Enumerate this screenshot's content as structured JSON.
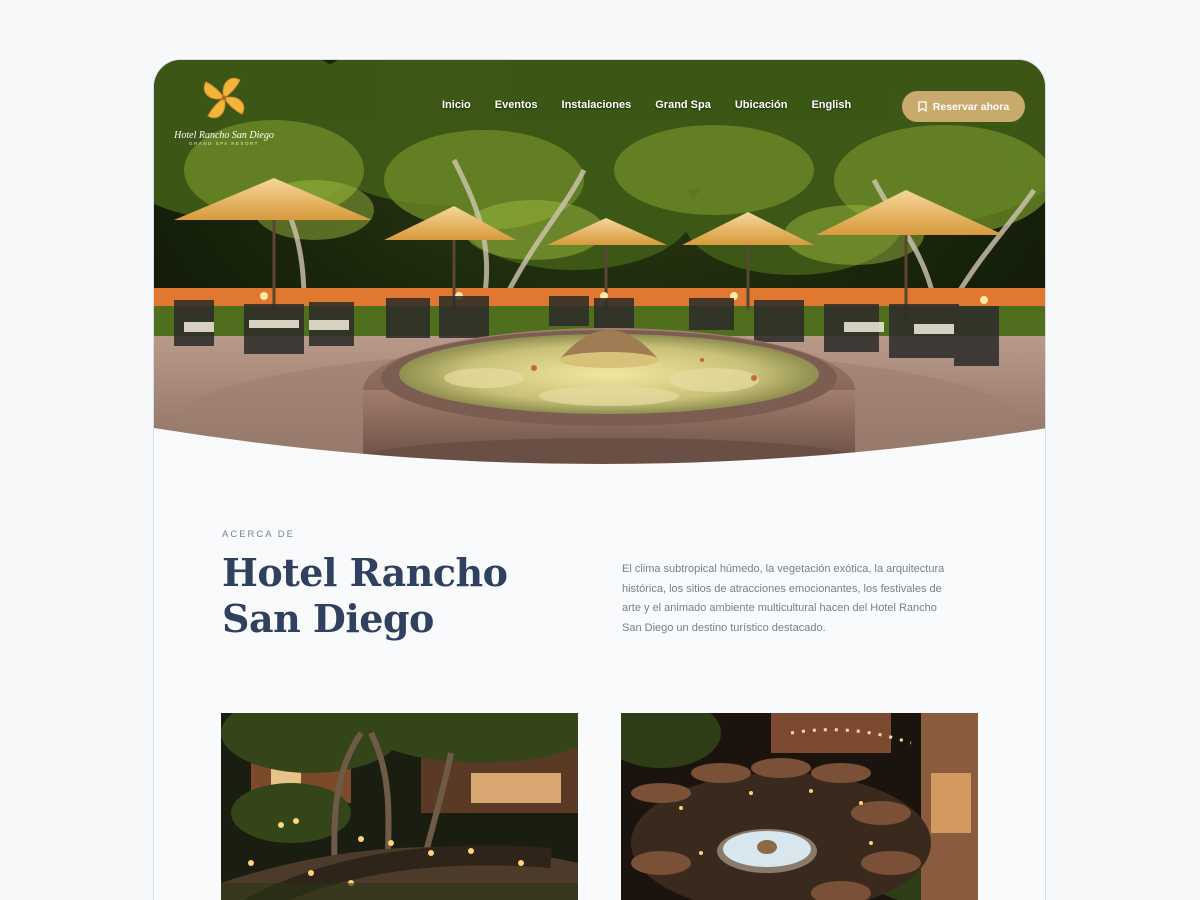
{
  "brand": {
    "name": "Hotel Rancho San Diego",
    "tagline": "GRAND SPA RESORT",
    "logo_icon": "pinwheel-flower-icon",
    "accent": "#c8aa6c",
    "logo_color": "#f2b53a"
  },
  "nav": {
    "items": [
      {
        "label": "Inicio"
      },
      {
        "label": "Eventos"
      },
      {
        "label": "Instalaciones"
      },
      {
        "label": "Grand Spa"
      },
      {
        "label": "Ubicación"
      },
      {
        "label": "English"
      }
    ],
    "cta_label": "Reservar ahora",
    "cta_icon": "bookmark-icon"
  },
  "hero": {
    "image": "night terrace with umbrellas, tables and central fountain"
  },
  "about": {
    "eyebrow": "ACERCA DE",
    "title": "Hotel Rancho San Diego",
    "description": "El clima subtropical húmedo, la vegetación exótica, la arquitectura histórica, los sitios de atracciones emocionantes, los festivales de arte y el animado ambiente multicultural hacen del Hotel Rancho San Diego un destino turístico destacado.",
    "title_color": "#2f415e"
  },
  "gallery": {
    "images": [
      {
        "name": "garden-path-night-photo"
      },
      {
        "name": "aerial-terrace-night-photo"
      }
    ]
  }
}
